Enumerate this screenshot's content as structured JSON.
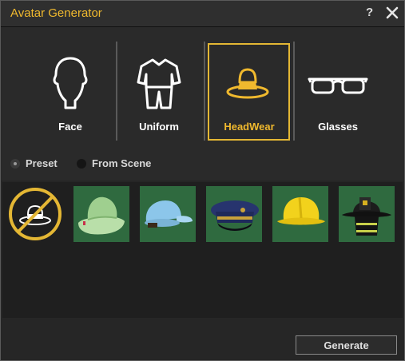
{
  "window": {
    "title": "Avatar Generator",
    "help_label": "?"
  },
  "categories": [
    {
      "label": "Face",
      "icon": "head-icon",
      "selected": false
    },
    {
      "label": "Uniform",
      "icon": "uniform-icon",
      "selected": false
    },
    {
      "label": "HeadWear",
      "icon": "hat-icon",
      "selected": true
    },
    {
      "label": "Glasses",
      "icon": "glasses-icon",
      "selected": false
    }
  ],
  "source": {
    "options": [
      {
        "label": "Preset",
        "selected": true
      },
      {
        "label": "From Scene",
        "selected": false
      }
    ]
  },
  "gallery": {
    "items": [
      {
        "name": "none",
        "icon": "no-hat-icon"
      },
      {
        "name": "bucket hat",
        "color": "#9fcf8f"
      },
      {
        "name": "baseball cap",
        "color": "#8cc6ea"
      },
      {
        "name": "police cap",
        "color": "#1f2a5a"
      },
      {
        "name": "hard hat",
        "color": "#f2d21c"
      },
      {
        "name": "firefighter helmet",
        "color": "#1a1a1a"
      }
    ]
  },
  "footer": {
    "generate_label": "Generate"
  },
  "colors": {
    "accent": "#f0b92e",
    "thumb_bg": "#2f6a3f"
  }
}
